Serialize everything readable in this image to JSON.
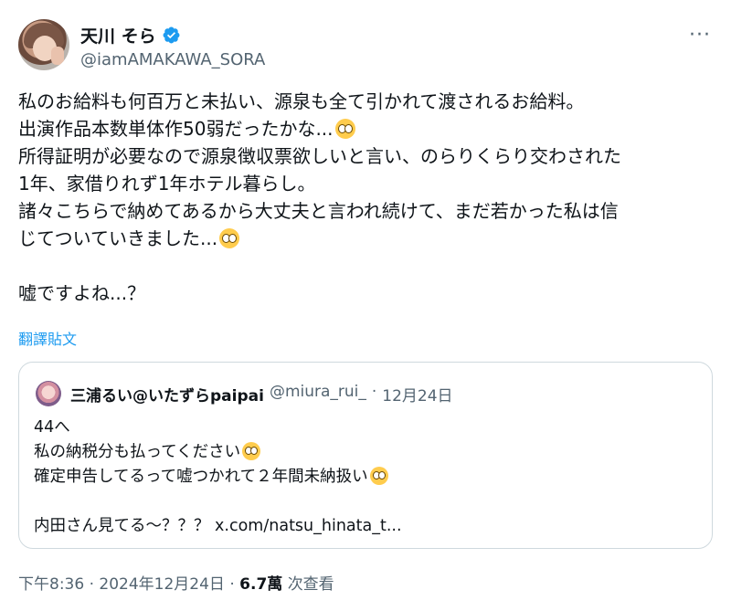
{
  "author": {
    "name": "天川 そら",
    "handle": "@iamAMAKAWA_SORA"
  },
  "tweet": {
    "lines": [
      "私のお給料も何百万と未払い、源泉も全て引かれて渡されるお給料。",
      "出演作品本数単体作50弱だったかな...",
      "所得証明が必要なので源泉徴収票欲しいと言い、のらりくらり交わされた",
      "1年、家借りれず1年ホテル暮らし。",
      "諸々こちらで納めてあるから大丈夫と言われ続けて、まだ若かった私は信",
      "じてついていきました...",
      "嘘ですよね...？"
    ],
    "translate_label": "翻譯貼文"
  },
  "quote": {
    "name": "三浦るい@いたずらpaipai",
    "handle": "@miura_rui_",
    "separator": "·",
    "date": "12月24日",
    "lines": [
      "44へ",
      "私の納税分も払ってください",
      "確定申告してるって嘘つかれて２年間未納扱い",
      "内田さん見てる〜？？？ x.com/natsu_hinata_t..."
    ]
  },
  "footer": {
    "time": "下午8:36",
    "dot1": "·",
    "date": "2024年12月24日",
    "dot2": "·",
    "views_count": "6.7萬",
    "views_label": "次查看"
  },
  "icons": {
    "verified_color": "#1d9bf0",
    "more": "more-icon",
    "emoji": "pleading-face-emoji"
  }
}
